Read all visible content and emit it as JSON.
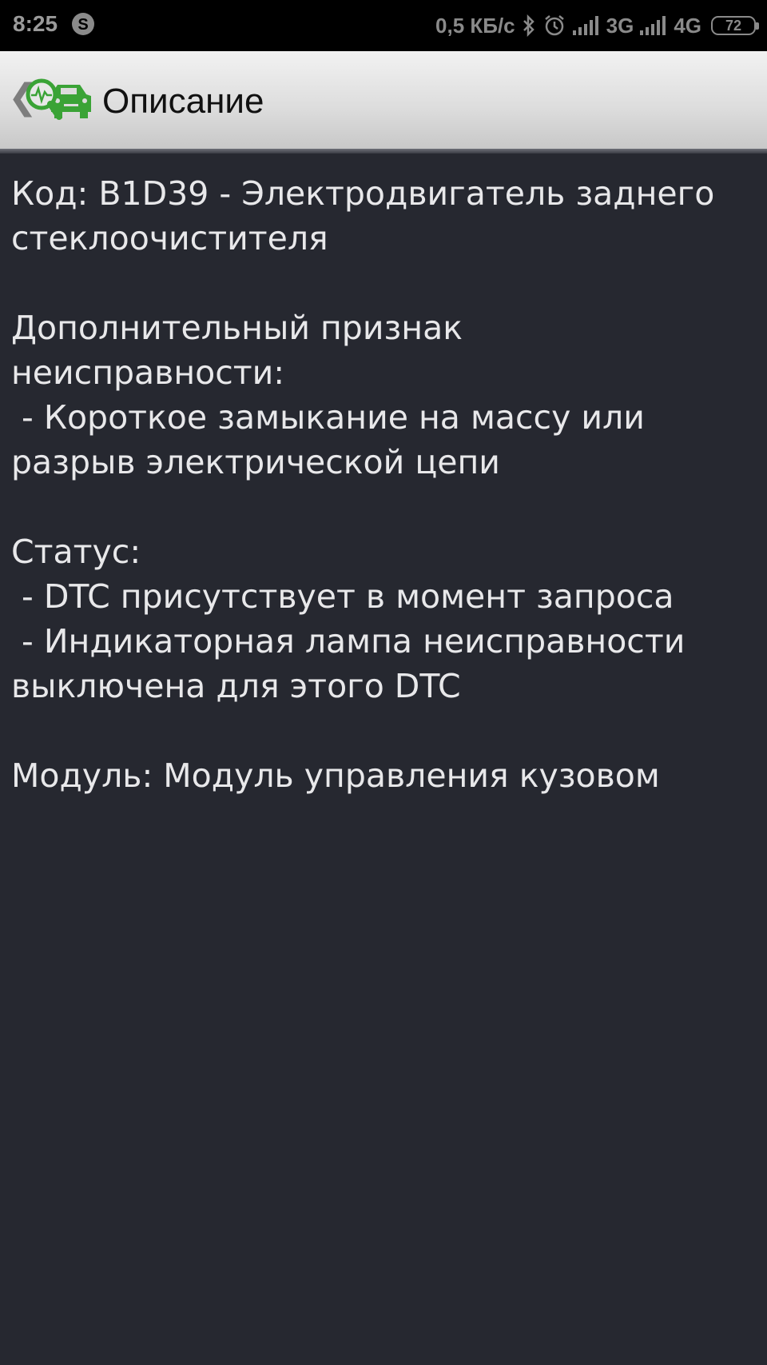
{
  "status_bar": {
    "time": "8:25",
    "speed": "0,5 КБ/с",
    "network_1": "3G",
    "network_2": "4G",
    "battery": "72",
    "icons": [
      "skype-icon",
      "bluetooth-icon",
      "alarm-icon",
      "signal-icon",
      "battery-icon"
    ]
  },
  "app_bar": {
    "back_icon": "chevron-left-icon",
    "logo_icon": "car-diagnostic-icon",
    "title": "Описание",
    "accent_color": "#3aa336"
  },
  "content": {
    "code_line_1": "Код: B1D39 - Электродвигатель заднего",
    "code_line_2": "стеклоочистителя",
    "extra_heading_1": "Дополнительный признак",
    "extra_heading_2": "неисправности:",
    "extra_item_1a": " - Короткое замыкание на массу или",
    "extra_item_1b": "разрыв электрической цепи",
    "status_heading": "Статус:",
    "status_item_1": " - DTC присутствует в момент запроса",
    "status_item_2a": " - Индикаторная лампа неисправности",
    "status_item_2b": "выключена для этого DTC",
    "module_line": "Модуль: Модуль управления кузовом"
  }
}
